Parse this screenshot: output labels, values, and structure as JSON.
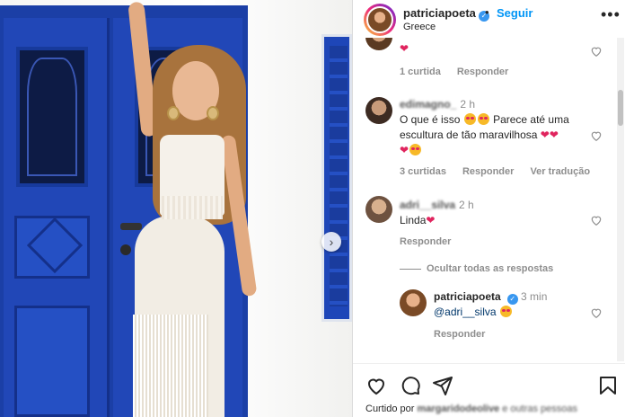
{
  "header": {
    "username": "patriciapoeta",
    "separator": "•",
    "follow_label": "Seguir",
    "location": "Greece",
    "more_label": "•••"
  },
  "comments": [
    {
      "user": "",
      "time": "",
      "text": "",
      "likes": "1 curtida",
      "reply_label": "Responder",
      "translate_label": ""
    },
    {
      "user": "edimagno_",
      "time": "2 h",
      "text_a": "O que é isso",
      "text_b": "Parece até uma",
      "text_c": "escultura de tão maravilhosa",
      "likes": "3 curtidas",
      "reply_label": "Responder",
      "translate_label": "Ver tradução"
    },
    {
      "user": "adri__silva",
      "time": "2 h",
      "text": "Linda",
      "reply_label": "Responder",
      "hide_replies_label": "Ocultar todas as respostas"
    },
    {
      "user": "patriciapoeta",
      "time": "3 min",
      "text": "@adri__silva",
      "reply_label": "Responder"
    }
  ],
  "footer": {
    "liked_prefix": "Curtido por",
    "liked_user": "margaridodeolive",
    "liked_suffix": "e outras pessoas"
  },
  "icons": {
    "like": "heart-icon",
    "comment": "comment-icon",
    "share": "paper-plane-icon",
    "save": "bookmark-icon"
  },
  "colors": {
    "accent": "#0095f6",
    "verified": "#3897f0",
    "heart": "#e0245e"
  }
}
